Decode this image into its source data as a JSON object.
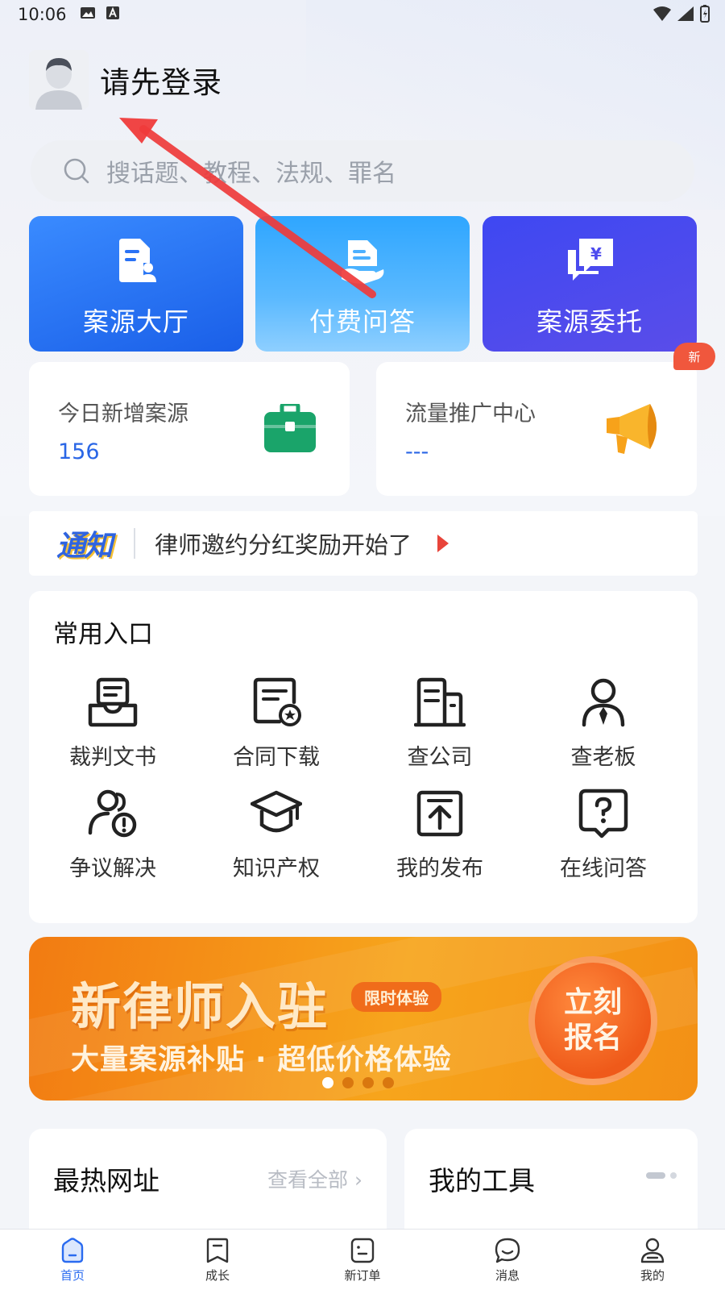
{
  "status_bar": {
    "time": "10:06"
  },
  "profile": {
    "login_text": "请先登录"
  },
  "search": {
    "placeholder": "搜话题、教程、法规、罪名"
  },
  "quick_cards": [
    {
      "label": "案源大厅",
      "icon": "document-user-icon"
    },
    {
      "label": "付费问答",
      "icon": "chat-hand-icon"
    },
    {
      "label": "案源委托",
      "icon": "yen-chat-icon"
    }
  ],
  "stats": [
    {
      "title": "今日新增案源",
      "value": "156",
      "icon": "briefcase-icon"
    },
    {
      "title": "流量推广中心",
      "value": "---",
      "icon": "megaphone-icon"
    }
  ],
  "new_badge": "新",
  "notice": {
    "logo": "通知",
    "text": "律师邀约分红奖励开始了"
  },
  "entries": {
    "heading": "常用入口",
    "items": [
      {
        "label": "裁判文书",
        "icon": "tray-document-icon"
      },
      {
        "label": "合同下载",
        "icon": "contract-star-icon"
      },
      {
        "label": "查公司",
        "icon": "building-icon"
      },
      {
        "label": "查老板",
        "icon": "person-tie-icon"
      },
      {
        "label": "争议解决",
        "icon": "people-alert-icon"
      },
      {
        "label": "知识产权",
        "icon": "graduation-cap-icon"
      },
      {
        "label": "我的发布",
        "icon": "upload-box-icon"
      },
      {
        "label": "在线问答",
        "icon": "question-bubble-icon"
      }
    ]
  },
  "banner": {
    "title": "新律师入驻",
    "tag": "限时体验",
    "subtitle": "大量案源补贴 · 超低价格体验",
    "button": "立刻报名",
    "slide_count": 4,
    "active_slide": 1
  },
  "panels": {
    "hot": {
      "title": "最热网址",
      "more": "查看全部"
    },
    "tools": {
      "title": "我的工具"
    }
  },
  "tabs": [
    {
      "label": "首页",
      "icon": "home-icon",
      "active": true
    },
    {
      "label": "成长",
      "icon": "bookmark-icon",
      "active": false
    },
    {
      "label": "新订单",
      "icon": "order-icon",
      "active": false
    },
    {
      "label": "消息",
      "icon": "message-icon",
      "active": false
    },
    {
      "label": "我的",
      "icon": "profile-icon",
      "active": false
    }
  ],
  "colors": {
    "accent_blue": "#2a6bf0",
    "annotation_arrow": "#ef3b3b",
    "badge_red": "#f0573d",
    "briefcase_green": "#1aa46a",
    "megaphone_orange": "#f7a21a"
  }
}
